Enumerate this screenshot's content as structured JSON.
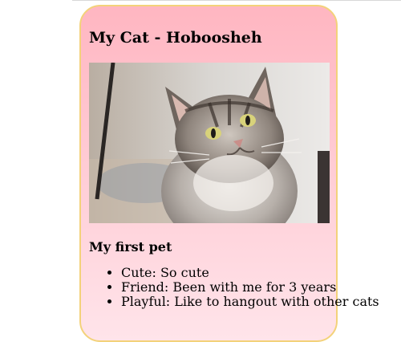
{
  "card": {
    "title": "My Cat - Hoboosheh",
    "image": {
      "alt": "Photo of a long-haired tabby cat with green eyes",
      "icon": "cat-photo"
    },
    "subtitle": "My first pet",
    "facts": [
      {
        "label": "Cute:",
        "value": "So cute"
      },
      {
        "label": "Friend:",
        "value": "Been with me for 3 years"
      },
      {
        "label": "Playful:",
        "value": "Like to hangout with other cats"
      }
    ]
  },
  "colors": {
    "card_gradient_top": "#ffb6c1",
    "card_gradient_bottom": "#ffe4ea",
    "card_border": "#f3d27a"
  }
}
